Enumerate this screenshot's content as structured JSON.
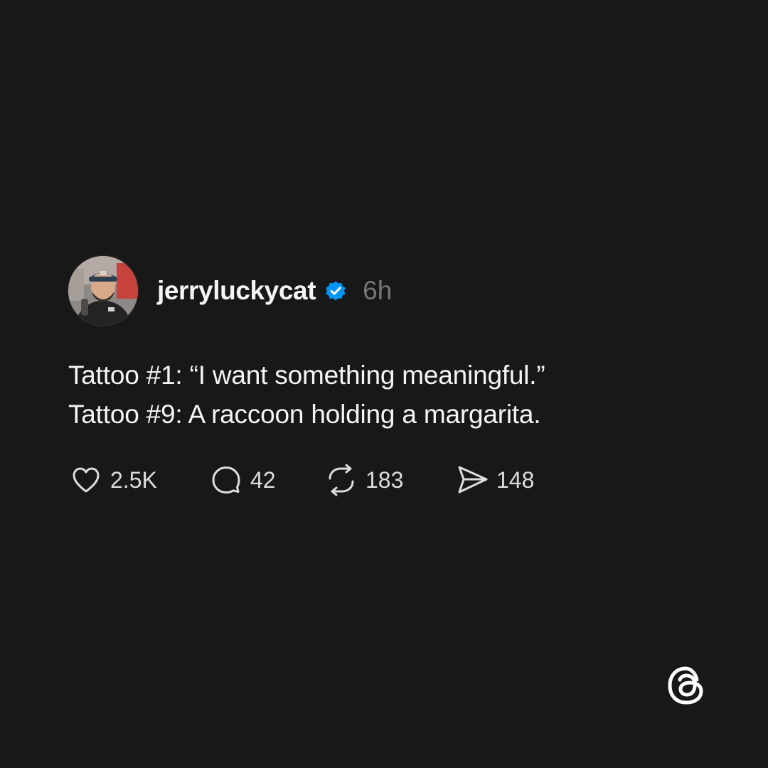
{
  "post": {
    "username": "jerryluckycat",
    "verified_icon": "verified-badge-icon",
    "timestamp": "6h",
    "lines": [
      "Tattoo #1: “I want something meaningful.”",
      "Tattoo #9: A raccoon holding a margarita."
    ],
    "actions": {
      "like": {
        "icon": "heart-icon",
        "count": "2.5K"
      },
      "reply": {
        "icon": "reply-bubble-icon",
        "count": "42"
      },
      "repost": {
        "icon": "repost-icon",
        "count": "183"
      },
      "share": {
        "icon": "send-icon",
        "count": "148"
      }
    }
  },
  "branding": {
    "logo": "threads-logo-icon"
  },
  "colors": {
    "background": "#181818",
    "text": "#f3f5f7",
    "muted": "#777777",
    "verified": "#0095f6"
  }
}
